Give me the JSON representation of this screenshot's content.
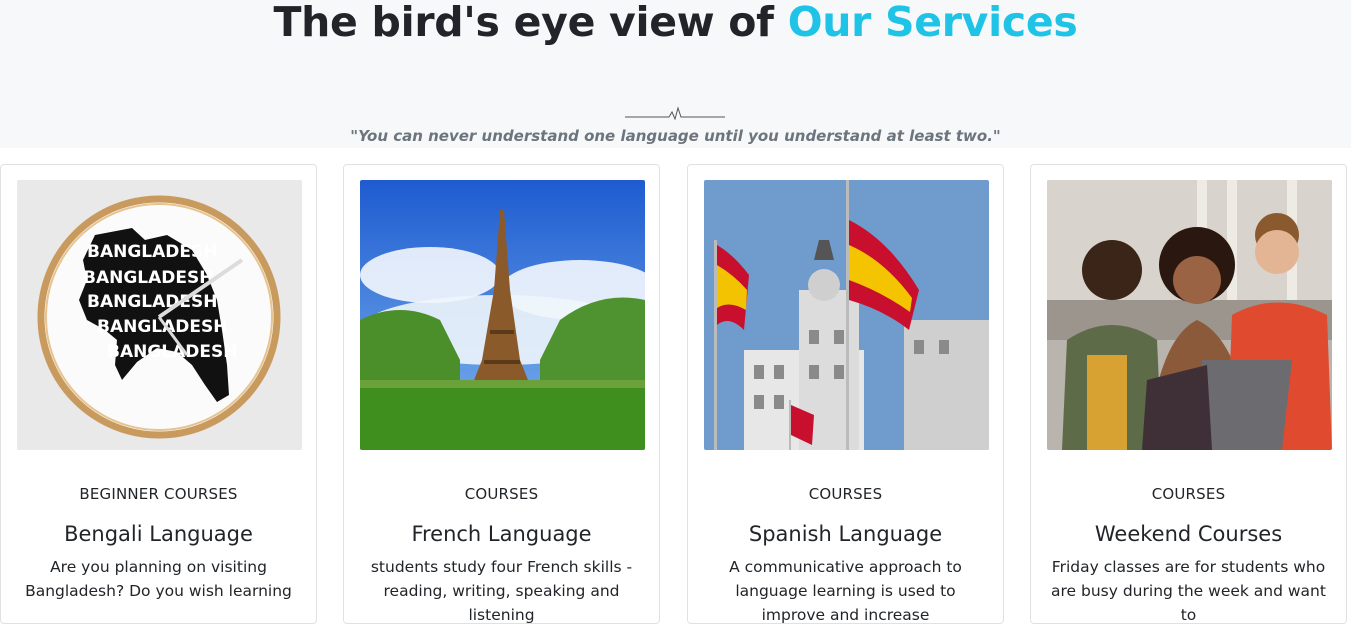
{
  "header": {
    "title_prefix": "The bird's eye view of",
    "title_accent": "Our Services",
    "quote": "\"You can never understand one language until you understand at least two.\""
  },
  "cards": [
    {
      "category": "BEGINNER COURSES",
      "title": "Bengali Language",
      "description": "Are you planning on visiting Bangladesh? Do you wish learning",
      "image": "bangladesh-map-clock",
      "map_word": "BANGLADESH"
    },
    {
      "category": "COURSES",
      "title": "French Language",
      "description": "students study four French skills - reading, writing, speaking and listening",
      "image": "eiffel-tower"
    },
    {
      "category": "COURSES",
      "title": "Spanish Language",
      "description": "A communicative approach to language learning is used to improve and increase",
      "image": "spanish-flags-building"
    },
    {
      "category": "COURSES",
      "title": "Weekend Courses",
      "description": "Friday classes are for students who are busy during the week and want to",
      "image": "students-laptop"
    }
  ],
  "colors": {
    "accent": "#1ec3e6",
    "hero_bg": "#f7f8fa",
    "quote": "#6c757d"
  }
}
